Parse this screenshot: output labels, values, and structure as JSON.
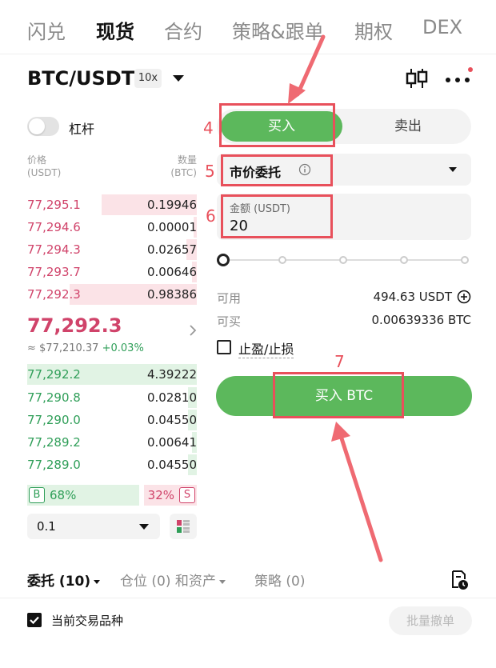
{
  "top_tabs": [
    "闪兑",
    "现货",
    "合约",
    "策略&跟单",
    "期权",
    "DEX"
  ],
  "header": {
    "pair": "BTC/USDT",
    "leverage_badge": "10x"
  },
  "margin_toggle": {
    "label": "杠杆",
    "on": false
  },
  "orderbook": {
    "price_header": "价格",
    "price_unit": "(USDT)",
    "qty_header": "数量",
    "qty_unit": "(BTC)",
    "asks": [
      {
        "price": "77,295.1",
        "qty": "0.19946",
        "depth": 0.56
      },
      {
        "price": "77,294.6",
        "qty": "0.00001",
        "depth": 0.02
      },
      {
        "price": "77,294.3",
        "qty": "0.02657",
        "depth": 0.06
      },
      {
        "price": "77,293.7",
        "qty": "0.00646",
        "depth": 0.03
      },
      {
        "price": "77,292.3",
        "qty": "0.98386",
        "depth": 0.75
      }
    ],
    "last_price": "77,292.3",
    "last_price_fiat": "≈ $77,210.37",
    "last_change": "+0.03%",
    "bids": [
      {
        "price": "77,292.2",
        "qty": "4.39222",
        "depth": 1.0
      },
      {
        "price": "77,290.8",
        "qty": "0.02810",
        "depth": 0.05
      },
      {
        "price": "77,290.0",
        "qty": "0.04550",
        "depth": 0.05
      },
      {
        "price": "77,289.2",
        "qty": "0.00641",
        "depth": 0.03
      },
      {
        "price": "77,289.0",
        "qty": "0.04550",
        "depth": 0.05
      }
    ],
    "buy_badge": "B",
    "sell_badge": "S",
    "buy_ratio": "68%",
    "sell_ratio": "32%",
    "precision": "0.1"
  },
  "trade_panel": {
    "buy_tab": "买入",
    "sell_tab": "卖出",
    "order_type": "市价委托",
    "amount_label": "金额 (USDT)",
    "amount_value": "20",
    "slider_percent": 0,
    "available_label": "可用",
    "available_value": "494.63 USDT",
    "can_buy_label": "可买",
    "can_buy_value": "0.00639336 BTC",
    "tpsl_label": "止盈/止损",
    "buy_button": "买入 BTC"
  },
  "annotations": [
    "4",
    "5",
    "6",
    "7"
  ],
  "bottom_tabs": {
    "orders": "委托 (10)",
    "positions": "仓位 (0) 和资产",
    "strategies": "策略 (0)"
  },
  "footer": {
    "current_pair_label": "当前交易品种",
    "cancel_all": "批量撤单"
  },
  "colors": {
    "buy_green": "#5cb85c",
    "ask_red": "#d0436a",
    "bid_green": "#2f9e58",
    "annotation_red": "#e8505b"
  }
}
